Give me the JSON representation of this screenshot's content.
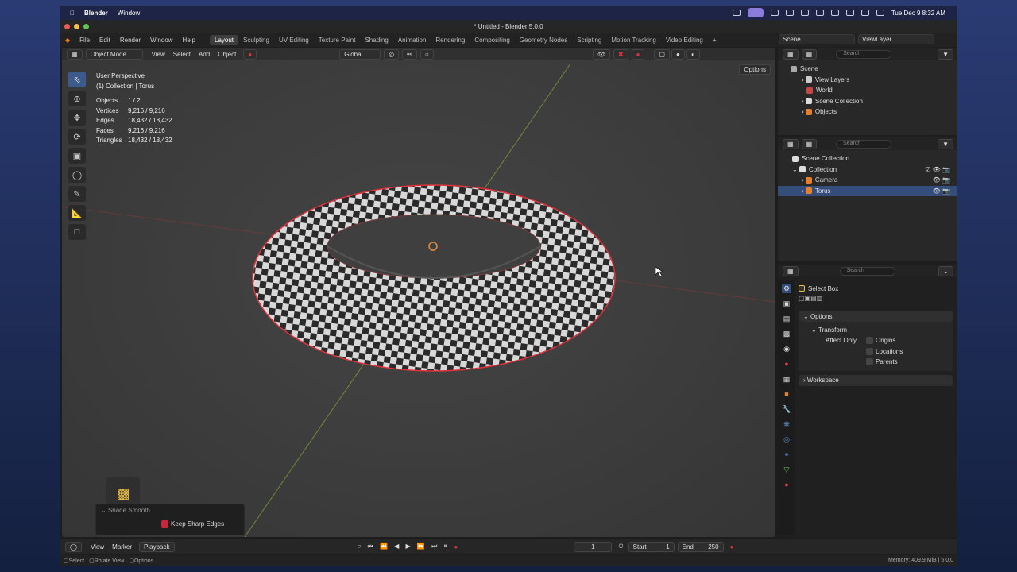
{
  "menubar": {
    "app": "Blender",
    "window": "Window",
    "datetime": "Tue Dec 9  8:32 AM"
  },
  "window": {
    "title": "* Untitled - Blender 5.0.0"
  },
  "topmenu": {
    "file": "File",
    "edit": "Edit",
    "render": "Render",
    "window": "Window",
    "help": "Help"
  },
  "workspaces": [
    "Layout",
    "Sculpting",
    "UV Editing",
    "Texture Paint",
    "Shading",
    "Animation",
    "Rendering",
    "Compositing",
    "Geometry Nodes",
    "Scripting",
    "Motion Tracking",
    "Video Editing"
  ],
  "scene": {
    "name": "Scene",
    "view_layer": "ViewLayer"
  },
  "viewport": {
    "mode": "Object Mode",
    "menus": {
      "view": "View",
      "select": "Select",
      "add": "Add",
      "object": "Object"
    },
    "transform_orientation": "Global",
    "options_label": "Options",
    "perspective": "User Perspective",
    "collection_info": "(1) Collection | Torus",
    "stats": [
      {
        "label": "Objects",
        "value": "1 / 2"
      },
      {
        "label": "Vertices",
        "value": "9,216 / 9,216"
      },
      {
        "label": "Edges",
        "value": "18,432 / 18,432"
      },
      {
        "label": "Faces",
        "value": "9,216 / 9,216"
      },
      {
        "label": "Triangles",
        "value": "18,432 / 18,432"
      }
    ]
  },
  "operator_panel": {
    "title": "Shade Smooth",
    "option": "Keep Sharp Edges",
    "checked": true
  },
  "outliner_top": {
    "search_placeholder": "Search",
    "items": {
      "scene": "Scene",
      "view_layers": "View Layers",
      "world": "World",
      "scene_collection": "Scene Collection",
      "objects": "Objects"
    }
  },
  "outliner": {
    "search_placeholder": "Search",
    "root": "Scene Collection",
    "collection": "Collection",
    "camera": "Camera",
    "torus": "Torus"
  },
  "properties": {
    "search_placeholder": "Search",
    "tool_name": "Select Box",
    "options": "Options",
    "transform": "Transform",
    "affect_only": "Affect Only",
    "origins": "Origins",
    "locations": "Locations",
    "parents": "Parents",
    "workspace": "Workspace"
  },
  "timeline": {
    "view": "View",
    "marker": "Marker",
    "playback": "Playback",
    "current_frame": "1",
    "start_label": "Start",
    "start": "1",
    "end_label": "End",
    "end": "250"
  },
  "statusbar": {
    "select": "Select",
    "rotate": "Rotate View",
    "options": "Options",
    "memory": "Memory: 409.9 MiB | 5.0.0"
  },
  "colors": {
    "accent": "#344d7a",
    "selection_outline": "#e0323c",
    "checker_light": "#d8d8d8",
    "checker_dark": "#2a2a2a"
  }
}
